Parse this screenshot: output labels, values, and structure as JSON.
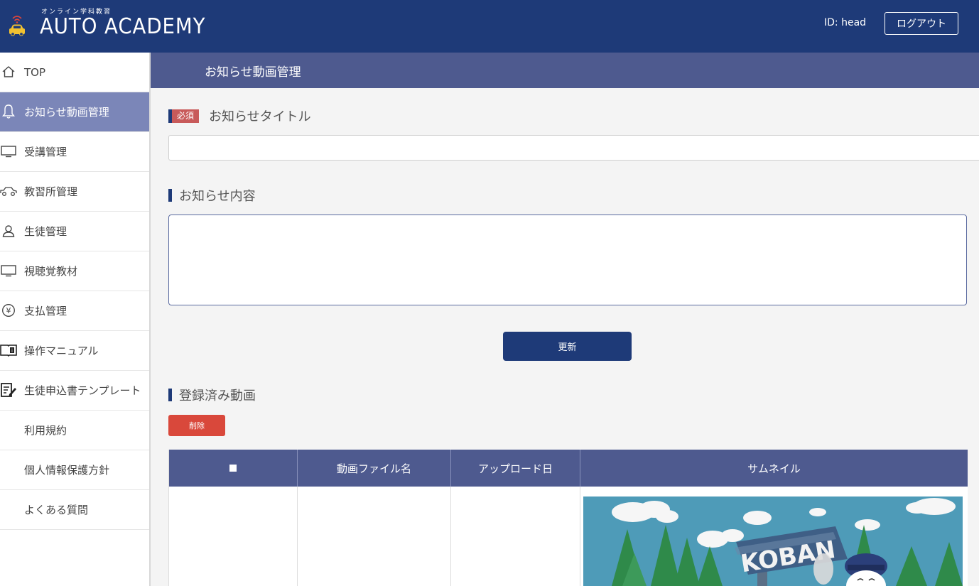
{
  "header": {
    "logo_sub": "オンライン学科教習",
    "logo_main": "AUTO ACADEMY",
    "user_id": "ID: head",
    "logout_label": "ログアウト"
  },
  "sidebar": {
    "items": [
      {
        "label": "TOP",
        "icon": "home-icon",
        "active": false
      },
      {
        "label": "お知らせ動画管理",
        "icon": "bell-icon",
        "active": true
      },
      {
        "label": "受講管理",
        "icon": "monitor-icon",
        "active": false
      },
      {
        "label": "教習所管理",
        "icon": "car-icon",
        "active": false
      },
      {
        "label": "生徒管理",
        "icon": "user-icon",
        "active": false
      },
      {
        "label": "視聴覚教材",
        "icon": "monitor-icon",
        "active": false
      },
      {
        "label": "支払管理",
        "icon": "yen-icon",
        "active": false
      },
      {
        "label": "操作マニュアル",
        "icon": "manual-icon",
        "active": false
      },
      {
        "label": "生徒申込書テンプレート",
        "icon": "form-edit-icon",
        "active": false
      },
      {
        "label": "利用規約",
        "icon": "",
        "active": false
      },
      {
        "label": "個人情報保護方針",
        "icon": "",
        "active": false
      },
      {
        "label": "よくある質問",
        "icon": "",
        "active": false
      }
    ]
  },
  "page": {
    "title": "お知らせ動画管理"
  },
  "form": {
    "required_badge": "必須",
    "title_label": "お知らせタイトル",
    "title_value": "",
    "content_label": "お知らせ内容",
    "content_value": "",
    "update_label": "更新"
  },
  "videos": {
    "section_label": "登録済み動画",
    "delete_label": "削除",
    "columns": [
      "",
      "動画ファイル名",
      "アップロード日",
      "サムネイル"
    ],
    "thumbnail_text": "KOBAN"
  },
  "colors": {
    "header_bg": "#1e3a78",
    "active_item_bg": "#7b86b8",
    "titlebar_bg": "#4e5a8f",
    "delete_red": "#d9483b"
  }
}
